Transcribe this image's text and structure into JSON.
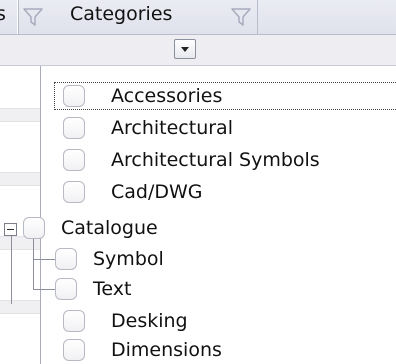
{
  "header": {
    "prev_column_label": "s",
    "categories_label": "Categories"
  },
  "filter": {
    "dropdown_open": true
  },
  "tree": {
    "items": [
      {
        "label": "Accessories",
        "checked": false,
        "focused": true
      },
      {
        "label": "Architectural",
        "checked": false
      },
      {
        "label": "Architectural Symbols",
        "checked": false
      },
      {
        "label": "Cad/DWG",
        "checked": false
      },
      {
        "label": "Catalogue",
        "checked": false,
        "expanded": true
      },
      {
        "label": "Symbol",
        "checked": false
      },
      {
        "label": "Text",
        "checked": false
      },
      {
        "label": "Desking",
        "checked": false
      },
      {
        "label": "Dimensions",
        "checked": false
      }
    ]
  },
  "icons": {
    "filter": "filter-funnel-icon",
    "dropdown": "chevron-down-icon",
    "collapse": "minus-box-icon"
  },
  "colors": {
    "header_bg": "#e3e5ef",
    "filter_row_bg": "#eeeef2",
    "panel_bg": "#ffffff",
    "checkbox_border": "#b8bac3"
  }
}
